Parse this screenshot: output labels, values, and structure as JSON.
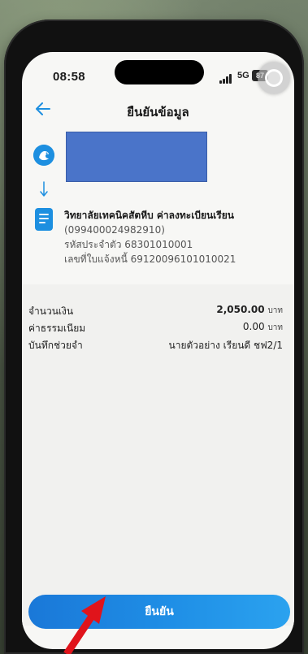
{
  "status_bar": {
    "time": "08:58",
    "network": "5G",
    "battery": "87"
  },
  "header": {
    "title": "ยืนยันข้อมูล"
  },
  "recipient": {
    "name": "วิทยาลัยเทคนิคสัตหีบ ค่าลงทะเบียนเรียน",
    "account": "(099400024982910)",
    "ref1": "รหัสประจำตัว 68301010001",
    "ref2": "เลขที่ใบแจ้งหนี้ 69120096101010021"
  },
  "details": {
    "amount_label": "จำนวนเงิน",
    "amount_value": "2,050.00",
    "amount_unit": "บาท",
    "fee_label": "ค่าธรรมเนียม",
    "fee_value": "0.00",
    "fee_unit": "บาท",
    "memo_label": "บันทึกช่วยจำ",
    "memo_value": "นายตัวอย่าง เรียนดี ชฟ2/1"
  },
  "confirm_button": {
    "label": "ยืนยัน"
  },
  "colors": {
    "accent": "#1d8fe0",
    "redaction": "#4a74c9",
    "annotation": "#e0141b"
  },
  "icons": {
    "back": "back-arrow-icon",
    "bank": "kasikorn-bank-logo-icon",
    "down_arrow": "down-arrow-icon",
    "recipient": "document-icon"
  }
}
